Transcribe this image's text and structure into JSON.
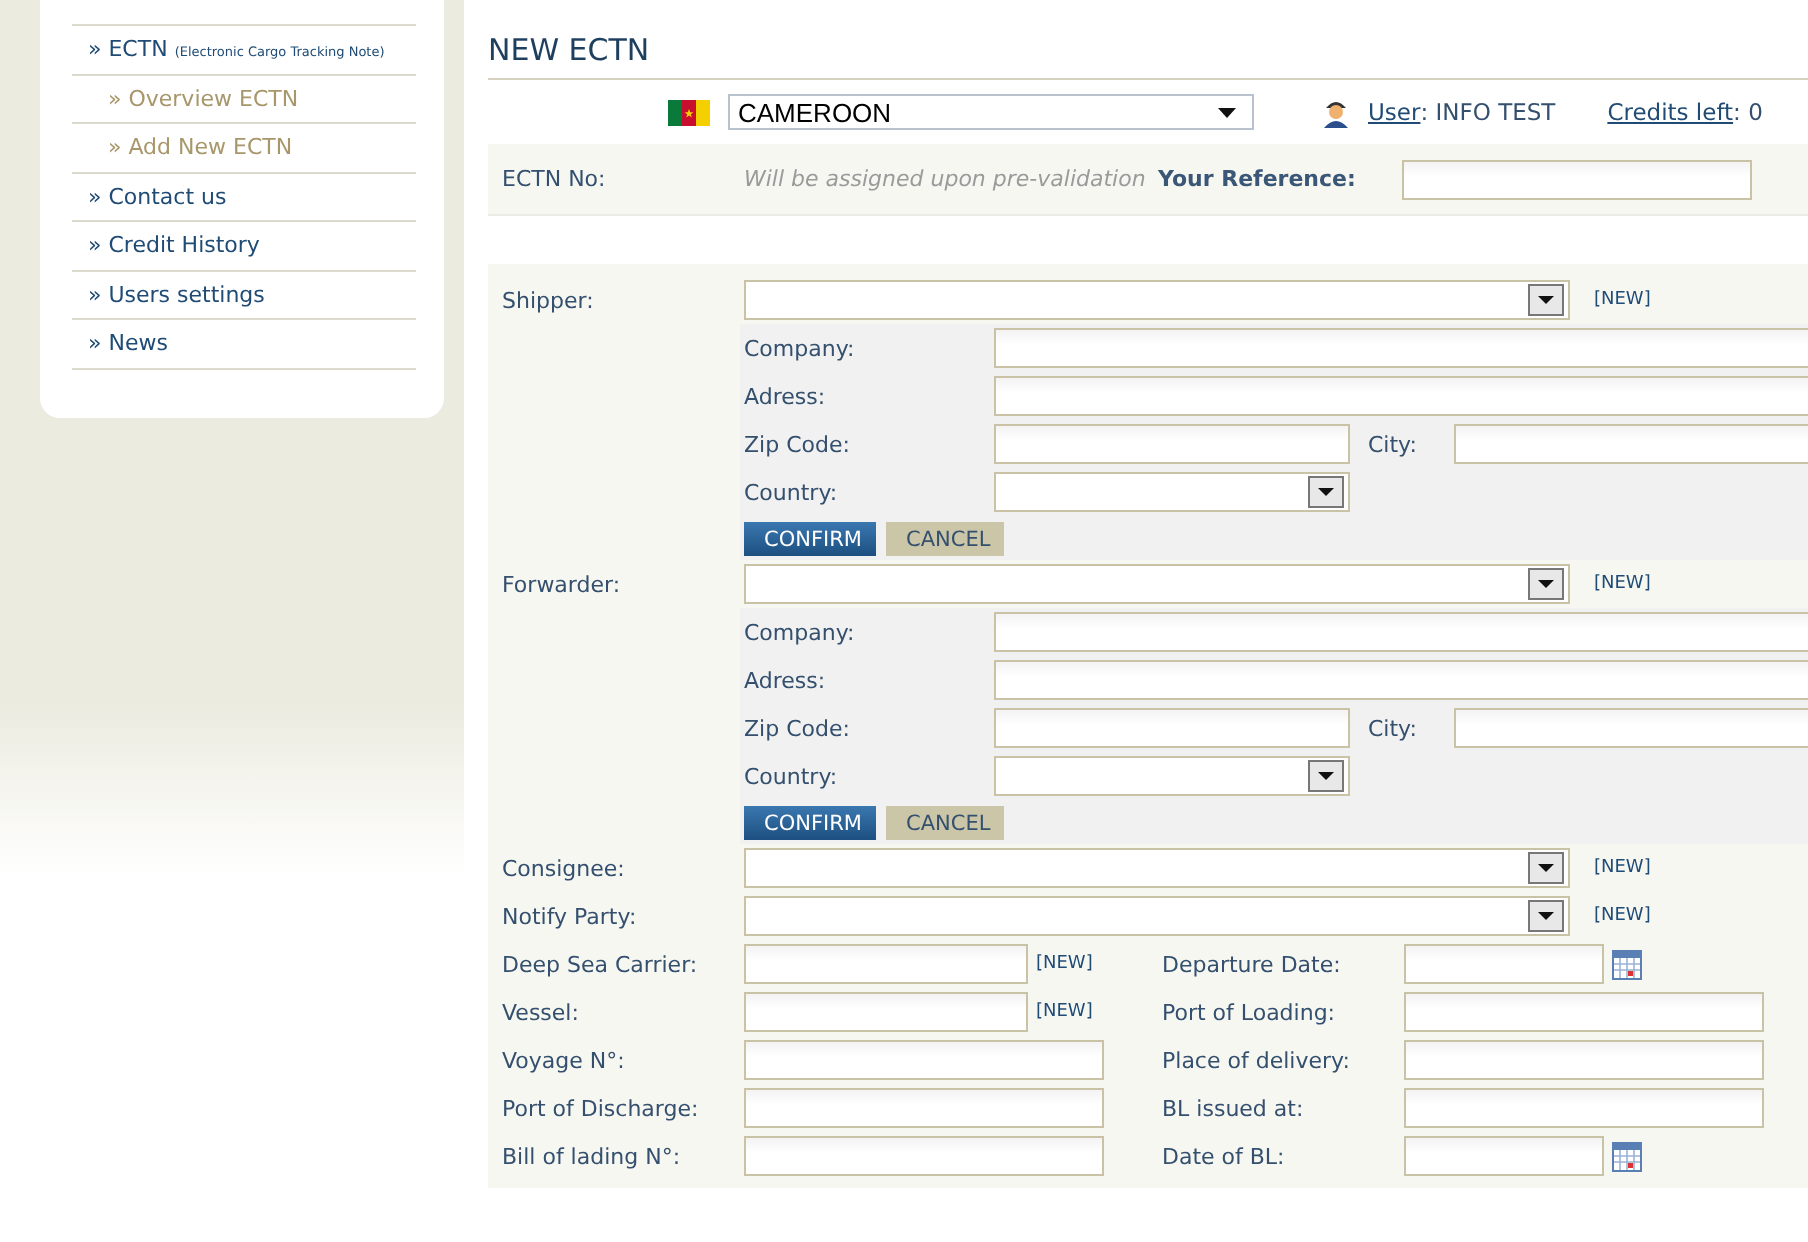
{
  "sidebar": {
    "items": [
      {
        "label": "» ECTN",
        "note": "(Electronic Cargo Tracking Note)",
        "children": [
          {
            "label": "» Overview ECTN"
          },
          {
            "label": "» Add New ECTN"
          }
        ]
      },
      {
        "label": "» Contact us"
      },
      {
        "label": "» Credit History"
      },
      {
        "label": "» Users settings"
      },
      {
        "label": "» News"
      }
    ]
  },
  "title": "NEW ECTN",
  "country_select": {
    "value": "CAMEROON"
  },
  "user": {
    "link": "User",
    "value": ": INFO TEST"
  },
  "credits": {
    "link": "Credits left",
    "value": ": 0"
  },
  "ectn": {
    "label": "ECTN No:",
    "hint": "Will be assigned upon pre-validation",
    "reference_label": "Your Reference:"
  },
  "parties": [
    {
      "label": "Shipper:",
      "new_link": "[NEW]",
      "details": {
        "company": "Company:",
        "address": "Adress:",
        "zip": "Zip Code:",
        "city": "City:",
        "country": "Country:",
        "confirm": "CONFIRM",
        "cancel": "CANCEL"
      }
    },
    {
      "label": "Forwarder:",
      "new_link": "[NEW]",
      "details": {
        "company": "Company:",
        "address": "Adress:",
        "zip": "Zip Code:",
        "city": "City:",
        "country": "Country:",
        "confirm": "CONFIRM",
        "cancel": "CANCEL"
      }
    },
    {
      "label": "Consignee:",
      "new_link": "[NEW]"
    },
    {
      "label": "Notify Party:",
      "new_link": "[NEW]"
    }
  ],
  "details_rows": [
    {
      "left": {
        "label": "Deep Sea Carrier:",
        "kind": "short",
        "new_link": "[NEW]"
      },
      "right": {
        "label": "Departure Date:",
        "kind": "date"
      }
    },
    {
      "left": {
        "label": "Vessel:",
        "kind": "short",
        "new_link": "[NEW]"
      },
      "right": {
        "label": "Port of Loading:",
        "kind": "text"
      }
    },
    {
      "left": {
        "label": "Voyage N°:",
        "kind": "text"
      },
      "right": {
        "label": "Place of delivery:",
        "kind": "text"
      }
    },
    {
      "left": {
        "label": "Port of Discharge:",
        "kind": "text"
      },
      "right": {
        "label": "BL issued at:",
        "kind": "text"
      }
    },
    {
      "left": {
        "label": "Bill of lading N°:",
        "kind": "text"
      },
      "right": {
        "label": "Date of BL:",
        "kind": "date"
      }
    }
  ]
}
